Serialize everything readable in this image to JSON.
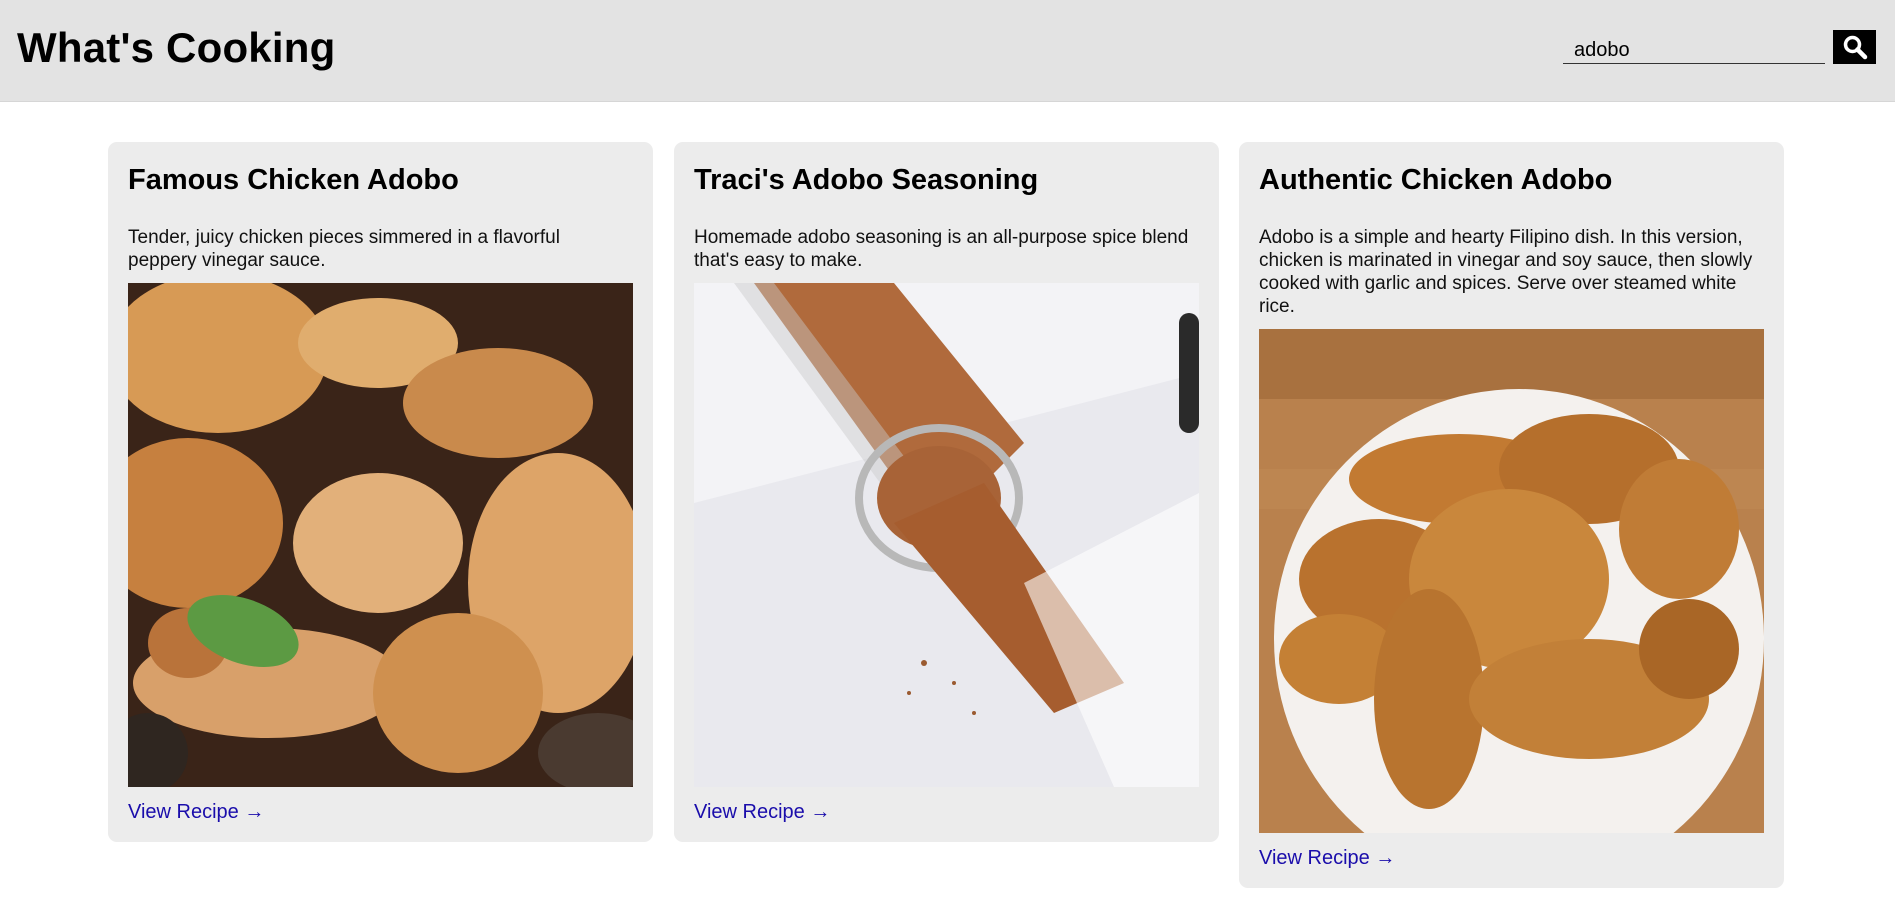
{
  "header": {
    "title": "What's Cooking",
    "search_value": "adobo",
    "search_icon": "search-icon"
  },
  "recipes": [
    {
      "title": "Famous Chicken Adobo",
      "description": "Tender, juicy chicken pieces simmered in a flavorful peppery vinegar sauce.",
      "link": "View Recipe →"
    },
    {
      "title": "Traci's Adobo Seasoning",
      "description": "Homemade adobo seasoning is an all-purpose spice blend that's easy to make.",
      "link": "View Recipe →"
    },
    {
      "title": "Authentic Chicken Adobo",
      "description": "Adobo is a simple and hearty Filipino dish. In this version, chicken is marinated in vinegar and soy sauce, then slowly cooked with garlic and spices. Serve over steamed white rice.",
      "link": "View Recipe →"
    }
  ],
  "colors": {
    "header_bg": "#e3e3e3",
    "card_bg": "#ececec",
    "link": "#1a0dab"
  }
}
